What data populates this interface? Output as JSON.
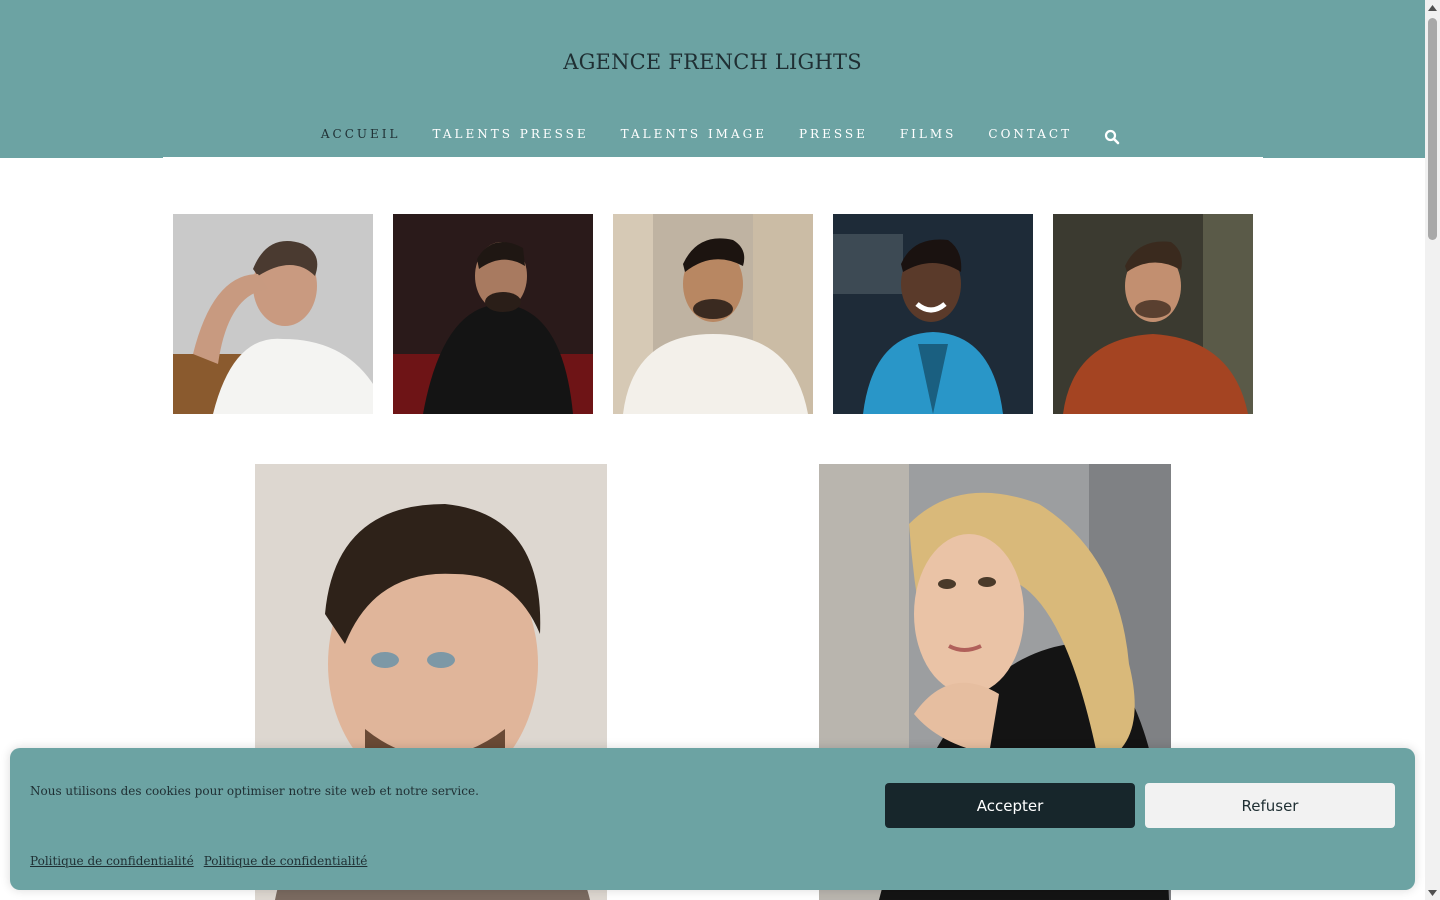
{
  "site": {
    "title": "AGENCE FRENCH LIGHTS"
  },
  "nav": {
    "items": [
      {
        "label": "ACCUEIL",
        "active": true
      },
      {
        "label": "TALENTS PRESSE"
      },
      {
        "label": "TALENTS IMAGE"
      },
      {
        "label": "PRESSE"
      },
      {
        "label": "FILMS"
      },
      {
        "label": "CONTACT"
      }
    ],
    "search_icon": "search-icon"
  },
  "gallery": {
    "thumbnails": [
      {
        "desc_icon": "portrait-man-white-tshirt"
      },
      {
        "desc_icon": "portrait-man-black-suit"
      },
      {
        "desc_icon": "portrait-man-white-shirt"
      },
      {
        "desc_icon": "portrait-woman-blue-dress"
      },
      {
        "desc_icon": "portrait-man-orange-sweater"
      }
    ],
    "featured": [
      {
        "desc_icon": "portrait-young-man"
      },
      {
        "desc_icon": "portrait-blonde-woman"
      }
    ]
  },
  "cookie": {
    "message": "Nous utilisons des cookies pour optimiser notre site web et notre service.",
    "accept_label": "Accepter",
    "refuse_label": "Refuser",
    "links": [
      "Politique de confidentialité",
      "Politique de confidentialité"
    ]
  },
  "colors": {
    "header_bg": "#6ca3a3",
    "accept_bg": "#17262b",
    "refuse_bg": "#f2f2f2"
  }
}
